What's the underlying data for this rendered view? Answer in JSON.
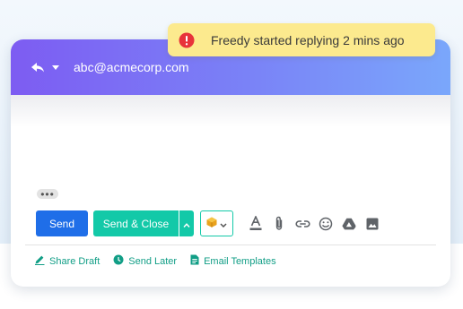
{
  "notification": {
    "text": "Freedy started replying 2 mins ago",
    "icon": "alert-circle-icon",
    "icon_color": "#e8333a",
    "background": "#fcea8e"
  },
  "composer": {
    "reply_icon": "reply-icon",
    "recipient": "abc@acmecorp.com",
    "header_gradient": [
      "#7d5cf2",
      "#7aa7fb"
    ],
    "ellipsis": "•••"
  },
  "toolbar": {
    "send_label": "Send",
    "send_color": "#1f6ee8",
    "send_close_label": "Send & Close",
    "send_close_color": "#13c9a8",
    "icons": [
      "caret-up-icon",
      "canned-response-icon",
      "font-color-icon",
      "attachment-icon",
      "link-icon",
      "emoji-icon",
      "google-drive-icon",
      "image-icon"
    ]
  },
  "footer": {
    "share_draft": "Share Draft",
    "send_later": "Send Later",
    "email_templates": "Email Templates",
    "accent": "#119e86"
  }
}
